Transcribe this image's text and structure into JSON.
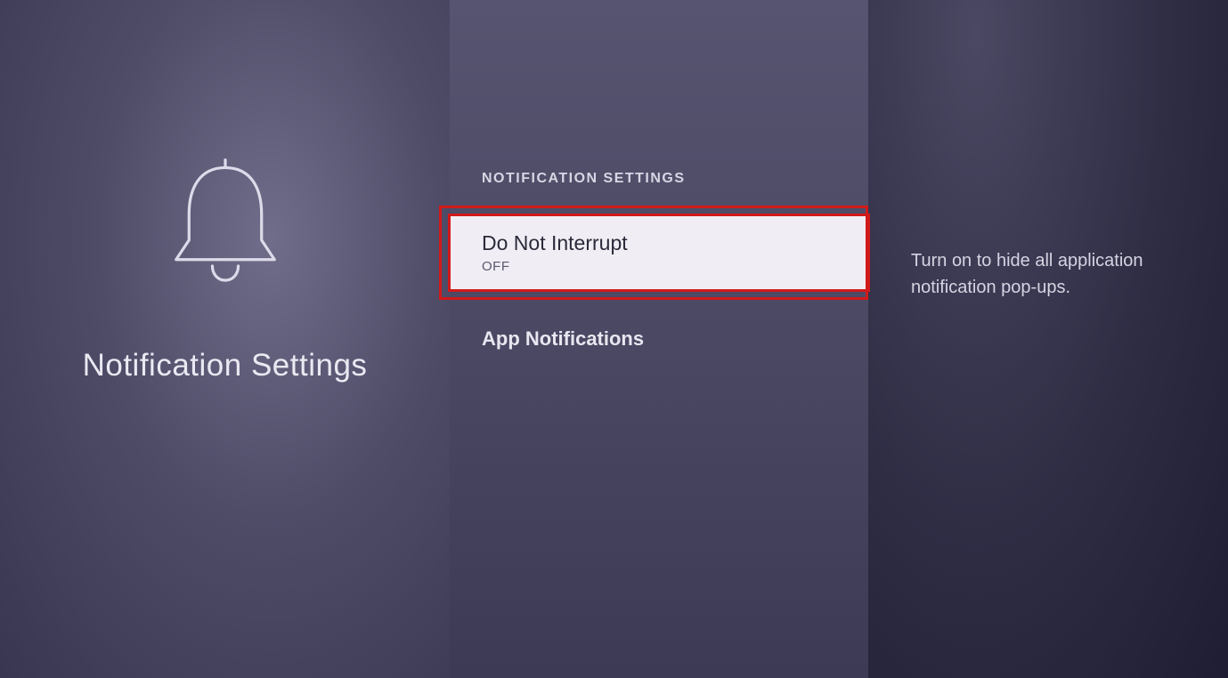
{
  "left": {
    "title": "Notification Settings"
  },
  "middle": {
    "header": "NOTIFICATION SETTINGS",
    "items": [
      {
        "title": "Do Not Interrupt",
        "status": "OFF",
        "selected": true
      },
      {
        "title": "App Notifications",
        "selected": false
      }
    ]
  },
  "right": {
    "description": "Turn on to hide all application notification pop-ups."
  }
}
